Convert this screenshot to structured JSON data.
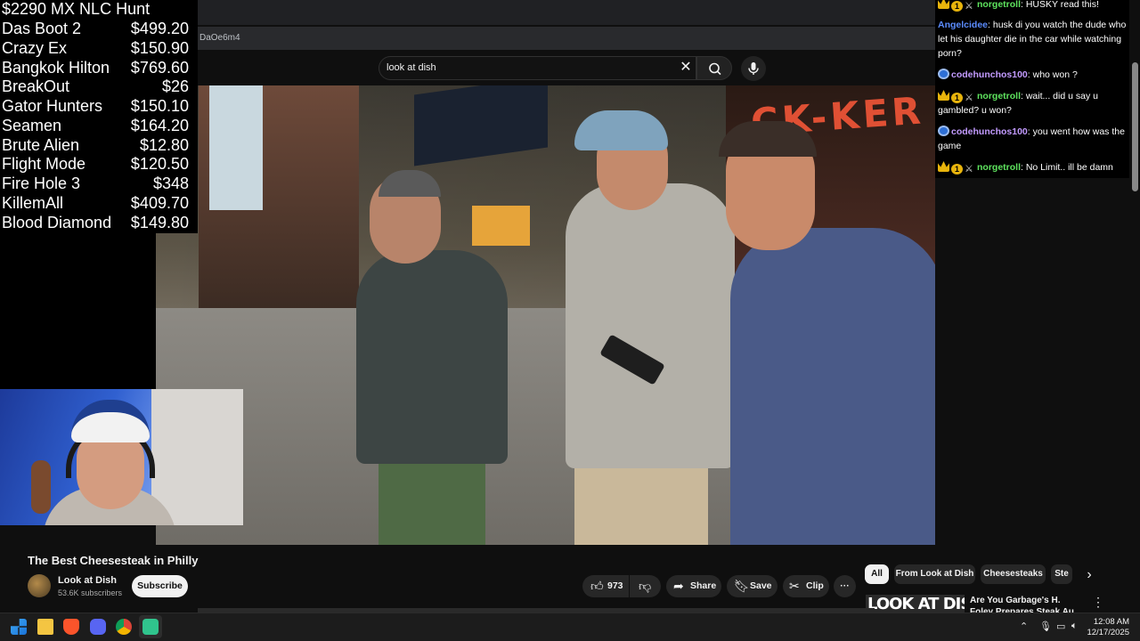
{
  "browser": {
    "address_fragment": "DaOe6m4"
  },
  "search": {
    "query": "look at dish",
    "clear_icon": "close-icon",
    "search_icon": "search-icon",
    "mic_icon": "microphone-icon"
  },
  "video": {
    "neon_sign": "CK-KER"
  },
  "slot_list": {
    "title": "$2290 MX NLC Hunt",
    "rows": [
      {
        "name": "Das Boot 2",
        "amount": "$499.20"
      },
      {
        "name": "Crazy Ex",
        "amount": "$150.90"
      },
      {
        "name": "Bangkok Hilton",
        "amount": "$769.60"
      },
      {
        "name": "BreakOut",
        "amount": "$26"
      },
      {
        "name": "Gator Hunters",
        "amount": "$150.10"
      },
      {
        "name": "Seamen",
        "amount": "$164.20"
      },
      {
        "name": "Brute Alien",
        "amount": "$12.80"
      },
      {
        "name": "Flight Mode",
        "amount": "$120.50"
      },
      {
        "name": "Fire Hole 3",
        "amount": "$348"
      },
      {
        "name": "KillemAll",
        "amount": "$409.70"
      },
      {
        "name": "Blood Diamond",
        "amount": "$149.80"
      }
    ]
  },
  "chat": {
    "messages": [
      {
        "user": "norgetroll",
        "text": ": HUSKY read this!"
      },
      {
        "user": "Angelcidee",
        "text": ": husk di you watch the dude who let his daughter die in the car while watching porn?"
      },
      {
        "user": "codehunchos100",
        "text": ": who won ?"
      },
      {
        "user": "norgetroll",
        "text": ": wait... did u say u gambled? u won?"
      },
      {
        "user": "codehunchos100",
        "text": ": you went how was the game"
      },
      {
        "user": "norgetroll",
        "text": ": No Limit.. ill be damn"
      }
    ]
  },
  "video_info": {
    "title": "The Best Cheesesteak in Philly",
    "channel_name": "Look at Dish",
    "subscribers": "53.6K subscribers",
    "subscribe_label": "Subscribe",
    "like_count": "973",
    "share_label": "Share",
    "save_label": "Save",
    "clip_label": "Clip",
    "more_label": "···"
  },
  "chips": [
    "All",
    "From Look at Dish",
    "Cheesesteaks",
    "Ste"
  ],
  "recommendation": {
    "thumb_text": "LOOK AT DISH",
    "title": "Are You Garbage's H. Foley Prepares Steak Au Poivre - Lo"
  },
  "taskbar": {
    "time": "12:08 AM",
    "date": "12/17/2025"
  }
}
